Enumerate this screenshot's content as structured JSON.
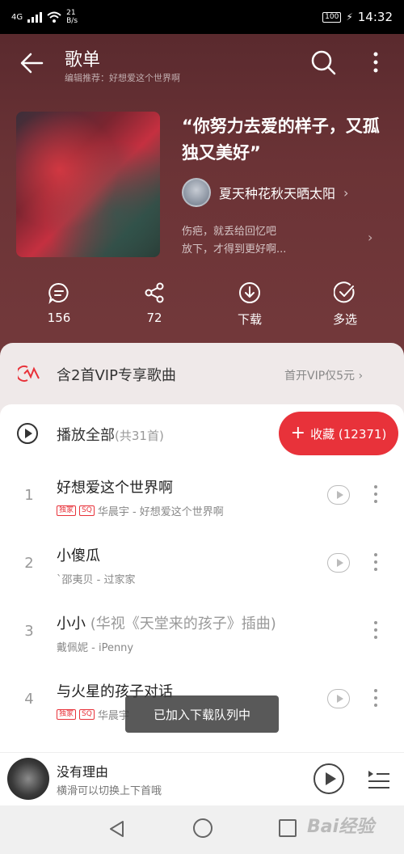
{
  "status_bar": {
    "network": "4G",
    "speed_value": "21",
    "speed_unit": "B/s",
    "battery": "100",
    "time": "14:32"
  },
  "header": {
    "title": "歌单",
    "subtitle": "编辑推荐：好想爱这个世界啊"
  },
  "playlist": {
    "title": "“你努力去爱的样子，又孤独又美好”",
    "creator": "夏天种花秋天晒太阳",
    "desc_line1": "伤疤，就丢给回忆吧",
    "desc_line2": "放下，才得到更好啊..."
  },
  "actions": {
    "comments": "156",
    "shares": "72",
    "download": "下载",
    "multi_select": "多选"
  },
  "vip": {
    "text": "含2首VIP专享歌曲",
    "link": "首开VIP仅5元"
  },
  "play_all": {
    "label": "播放全部",
    "count": "(共31首)"
  },
  "collect": {
    "label": "收藏 (12371)"
  },
  "songs": [
    {
      "index": "1",
      "title": "好想爱这个世界啊",
      "alt": "",
      "tag1": "独家",
      "tag2": "SQ",
      "artist": "华晨宇 - 好想爱这个世界啊"
    },
    {
      "index": "2",
      "title": "小傻瓜",
      "alt": "",
      "artist": "`邵夷贝 - 过家家"
    },
    {
      "index": "3",
      "title": "小小",
      "alt": "(华视《天堂来的孩子》插曲)",
      "artist": "戴佩妮 - iPenny"
    },
    {
      "index": "4",
      "title": "与火星的孩子对话",
      "alt": "",
      "tag1": "独家",
      "tag2": "SQ",
      "artist": "华晨宇"
    }
  ],
  "toast": "已加入下载队列中",
  "mini_player": {
    "title": "没有理由",
    "subtitle": "横滑可以切换上下首哦"
  },
  "watermark": "Bai经验",
  "colors": {
    "accent": "#e8323a",
    "header_bg": "#6b3336"
  }
}
